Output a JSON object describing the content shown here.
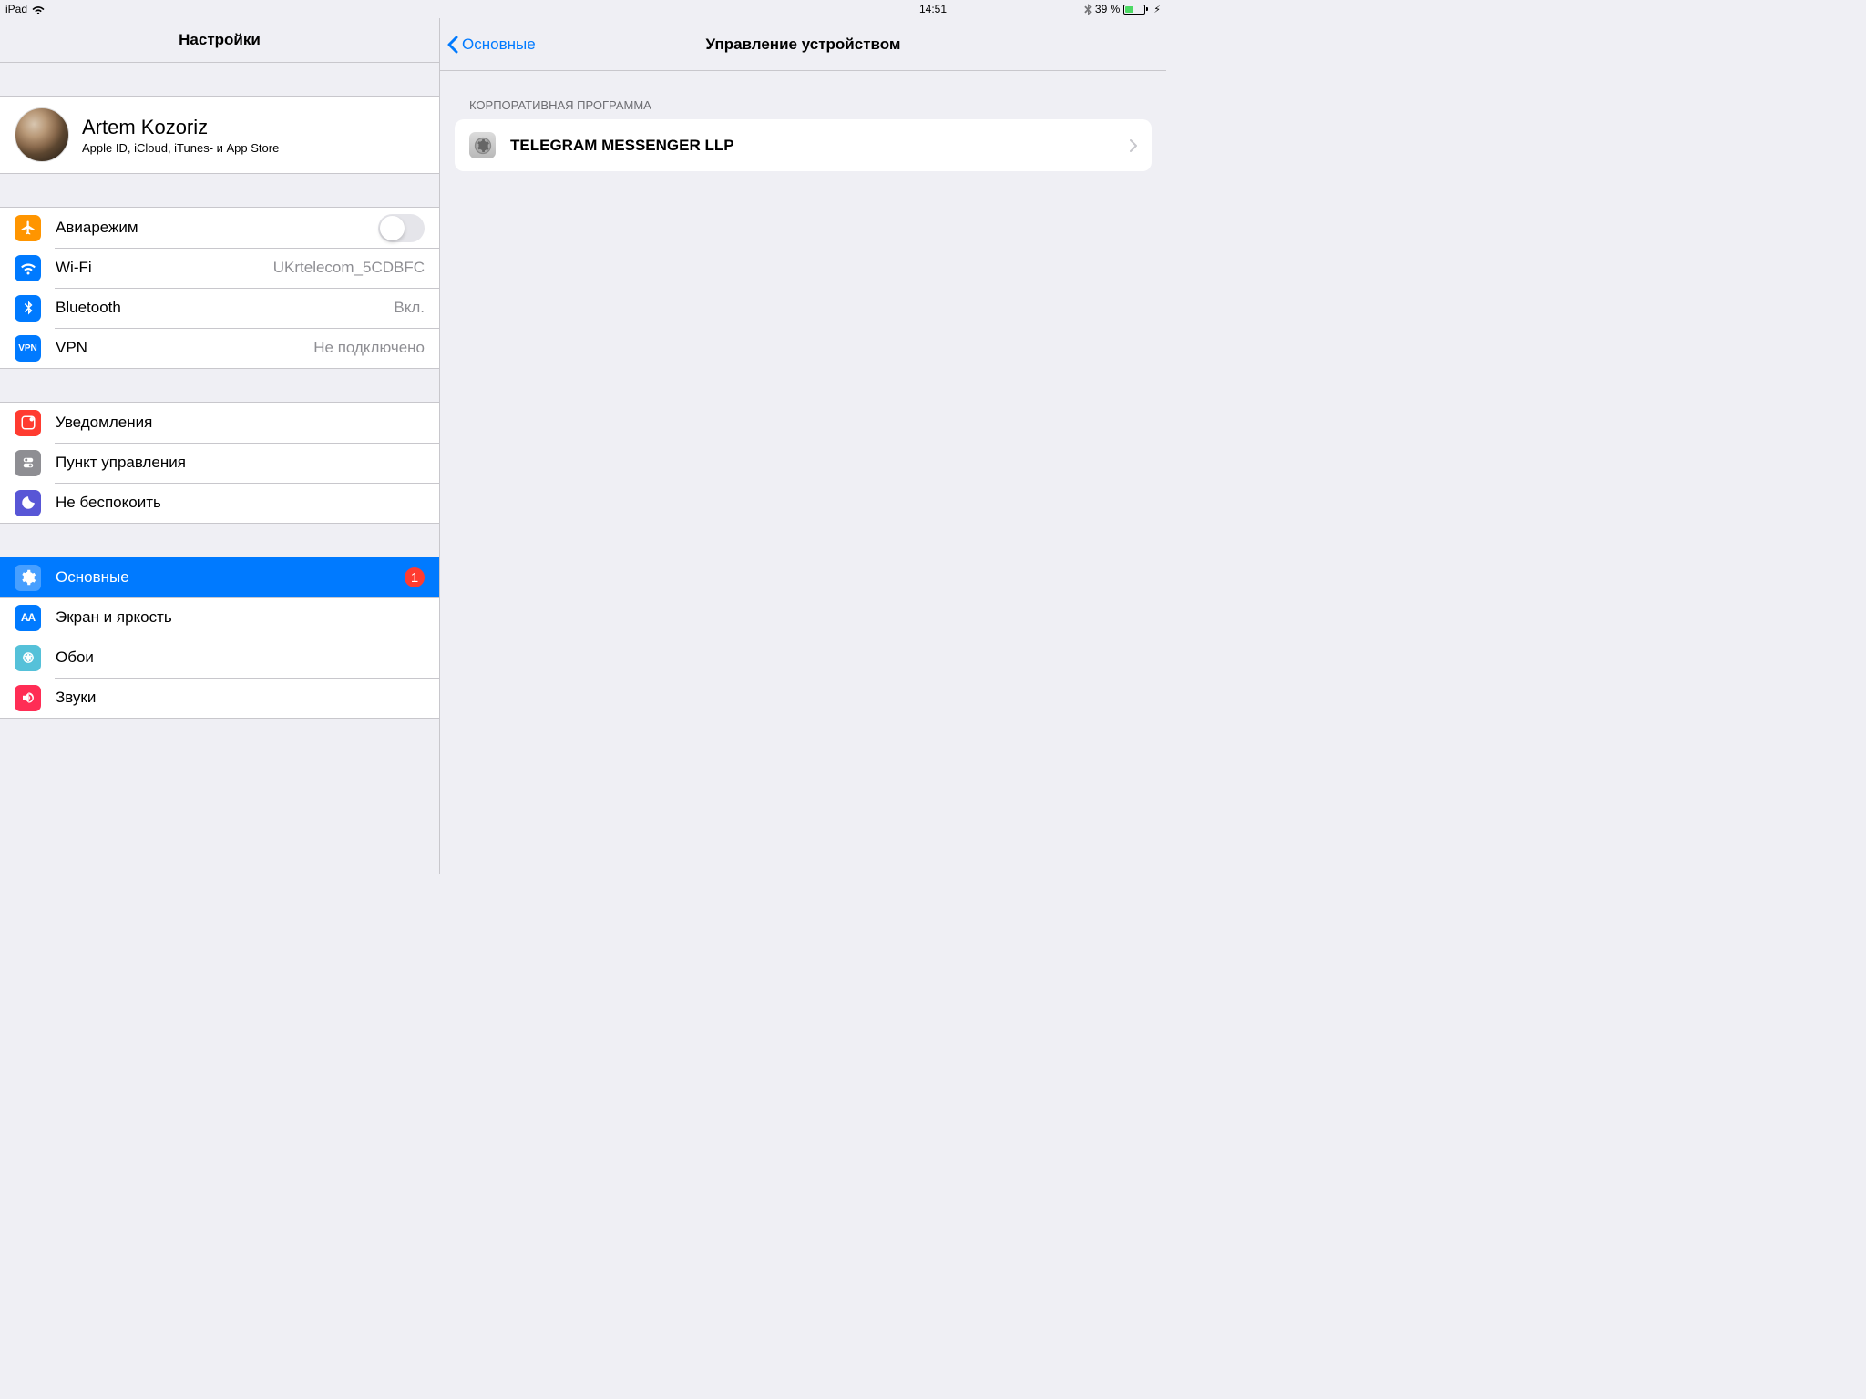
{
  "status": {
    "device": "iPad",
    "time": "14:51",
    "battery_text": "39 %"
  },
  "sidebar": {
    "title": "Настройки",
    "profile": {
      "name": "Artem Kozoriz",
      "subtitle": "Apple ID, iCloud, iTunes- и App Store"
    },
    "airplane": "Авиарежим",
    "wifi": {
      "label": "Wi-Fi",
      "value": "UKrtelecom_5CDBFC"
    },
    "bluetooth": {
      "label": "Bluetooth",
      "value": "Вкл."
    },
    "vpn": {
      "label": "VPN",
      "value": "Не подключено",
      "badge": "VPN"
    },
    "notifications": "Уведомления",
    "control_center": "Пункт управления",
    "dnd": "Не беспокоить",
    "general": {
      "label": "Основные",
      "badge": "1"
    },
    "display": {
      "label": "Экран и яркость",
      "badge": "AA"
    },
    "wallpaper": "Обои",
    "sounds": "Звуки"
  },
  "detail": {
    "back": "Основные",
    "title": "Управление устройством",
    "section": "КОРПОРАТИВНАЯ ПРОГРАММА",
    "item": "TELEGRAM MESSENGER LLP"
  }
}
